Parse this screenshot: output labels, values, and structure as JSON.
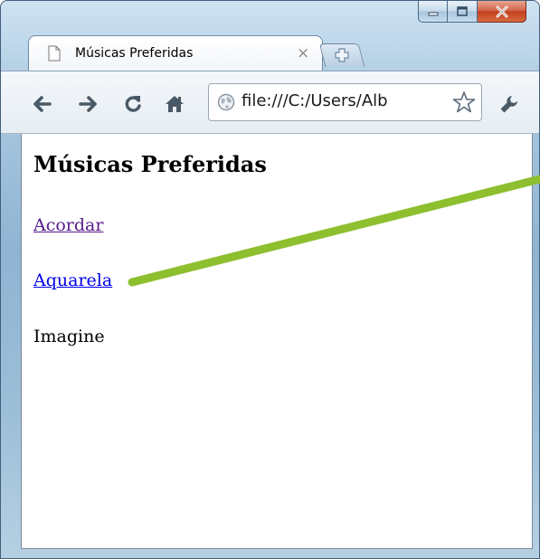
{
  "window": {
    "controls": {
      "minimize_icon": "minimize-icon",
      "maximize_icon": "maximize-icon",
      "close_icon": "close-icon"
    }
  },
  "tab": {
    "title": "Músicas Preferidas",
    "close_glyph": "×",
    "page_icon": "page-icon"
  },
  "new_tab": {
    "icon": "plus-icon"
  },
  "toolbar": {
    "back_icon": "back-arrow-icon",
    "forward_icon": "forward-arrow-icon",
    "reload_icon": "reload-icon",
    "home_icon": "home-icon",
    "wrench_icon": "wrench-icon"
  },
  "omnibox": {
    "url": "file:///C:/Users/Alb",
    "globe_icon": "globe-icon",
    "star_icon": "star-icon"
  },
  "page": {
    "heading": "Músicas Preferidas",
    "links": [
      {
        "text": "Acordar",
        "state": "visited",
        "color": "#551a8b"
      },
      {
        "text": "Aquarela",
        "state": "unvisited",
        "color": "#0000ee"
      }
    ],
    "plain_text": "Imagine"
  },
  "annotation": {
    "color": "#8dbf2f"
  }
}
